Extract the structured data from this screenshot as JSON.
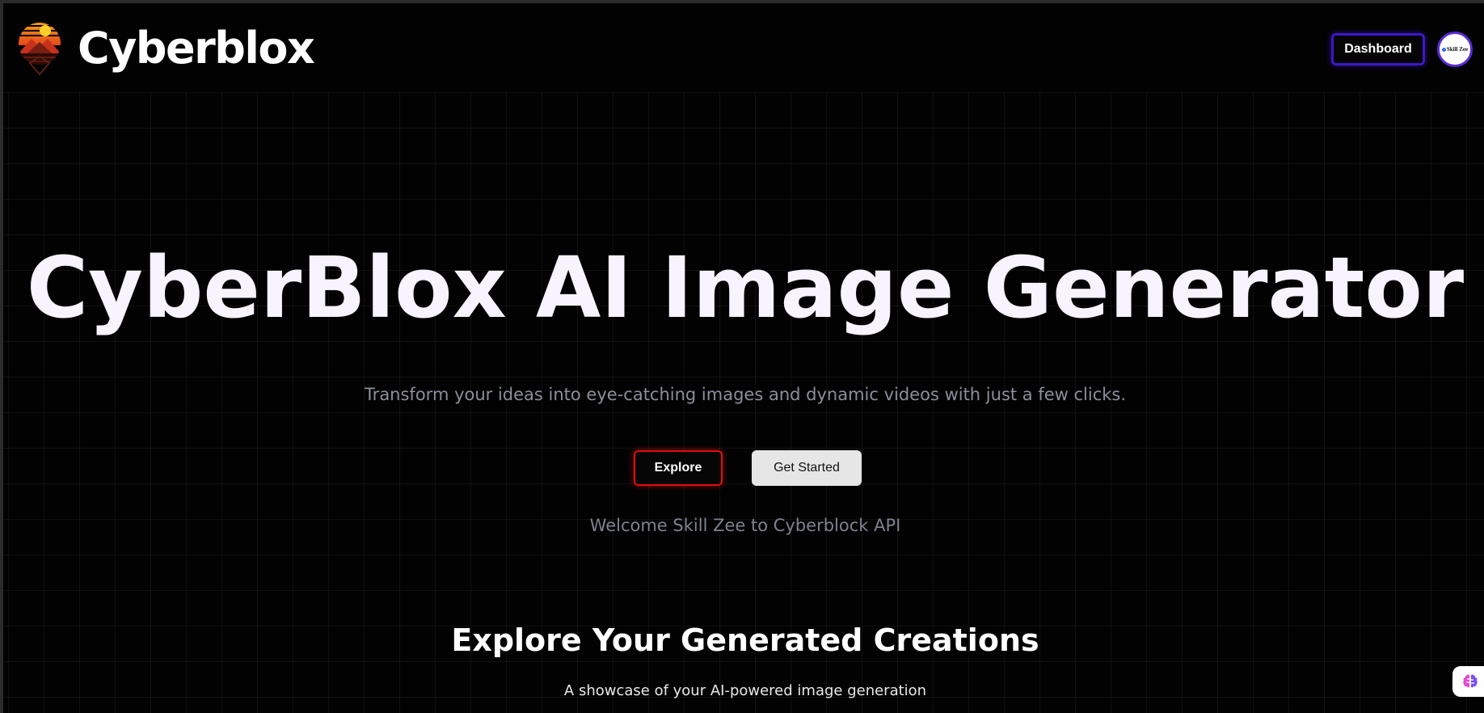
{
  "header": {
    "brand": "Cyberblox",
    "dashboard_label": "Dashboard",
    "avatar_text": "Skill Zee"
  },
  "hero": {
    "title": "CyberBlox AI Image Generator",
    "subtitle": "Transform your ideas into eye-catching images and dynamic videos with just a few clicks.",
    "explore_label": "Explore",
    "get_started_label": "Get Started",
    "welcome": "Welcome Skill Zee to Cyberblock API"
  },
  "gallery": {
    "title": "Explore Your Generated Creations",
    "subtitle": "A showcase of your AI-powered image generation"
  },
  "colors": {
    "background": "#020202",
    "dashboard_border": "#3d16c9",
    "explore_border": "#e10e0e",
    "get_started_bg": "#e6e6e6",
    "muted_text": "#8a8f9c"
  },
  "icons": {
    "logo": "sunset-mountain-logo-icon",
    "floating": "brain-icon"
  }
}
